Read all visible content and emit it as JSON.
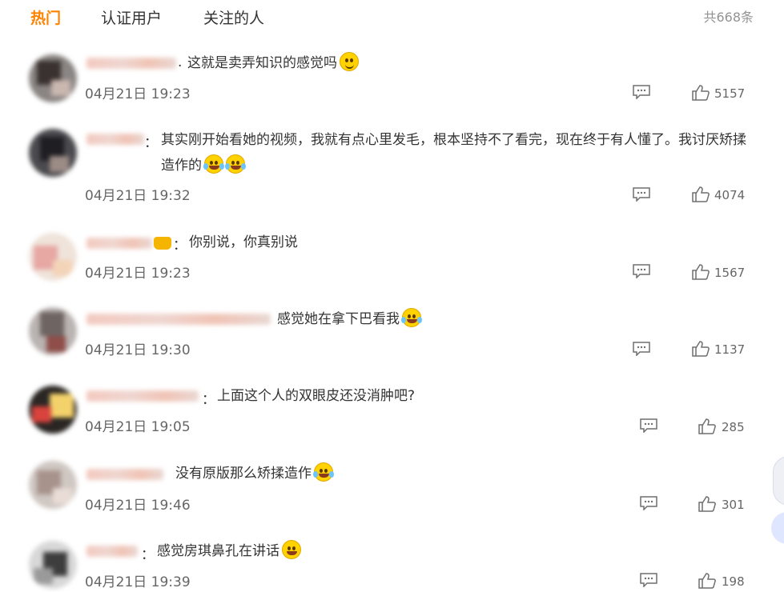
{
  "tabs": {
    "hot": "热门",
    "verified": "认证用户",
    "following": "关注的人"
  },
  "total": "共668条",
  "comments": [
    {
      "sep": ".",
      "text": "这就是卖弄知识的感觉吗",
      "emoji": "smile",
      "time": "04月21日 19:23",
      "likes": "5157"
    },
    {
      "sep": "：",
      "text": "其实刚开始看她的视频，我就有点心里发毛，根本坚持不了看完，现在终于有人懂了。我讨厌矫揉造作的",
      "emoji": "cry2",
      "time": "04月21日 19:32",
      "likes": "4074"
    },
    {
      "sep": "：",
      "text": "你别说，你真别说",
      "emoji": "",
      "time": "04月21日 19:23",
      "likes": "1567"
    },
    {
      "sep": "",
      "text": "感觉她在拿下巴看我",
      "emoji": "cry",
      "time": "04月21日 19:30",
      "likes": "1137"
    },
    {
      "sep": "：",
      "text": "上面这个人的双眼皮还没消肿吧?",
      "emoji": "",
      "time": "04月21日 19:05",
      "likes": "285"
    },
    {
      "sep": "",
      "text": "没有原版那么矫揉造作",
      "emoji": "cry",
      "time": "04月21日 19:46",
      "likes": "301"
    },
    {
      "sep": "：",
      "text": "感觉房琪鼻孔在讲话",
      "emoji": "laugh",
      "time": "04月21日 19:39",
      "likes": "198"
    }
  ],
  "colors": {
    "accent": "#ff8200",
    "text": "#333333",
    "muted": "#939393"
  },
  "icons": {
    "reply": "comment-bubble-icon",
    "like": "thumbs-up-icon"
  }
}
